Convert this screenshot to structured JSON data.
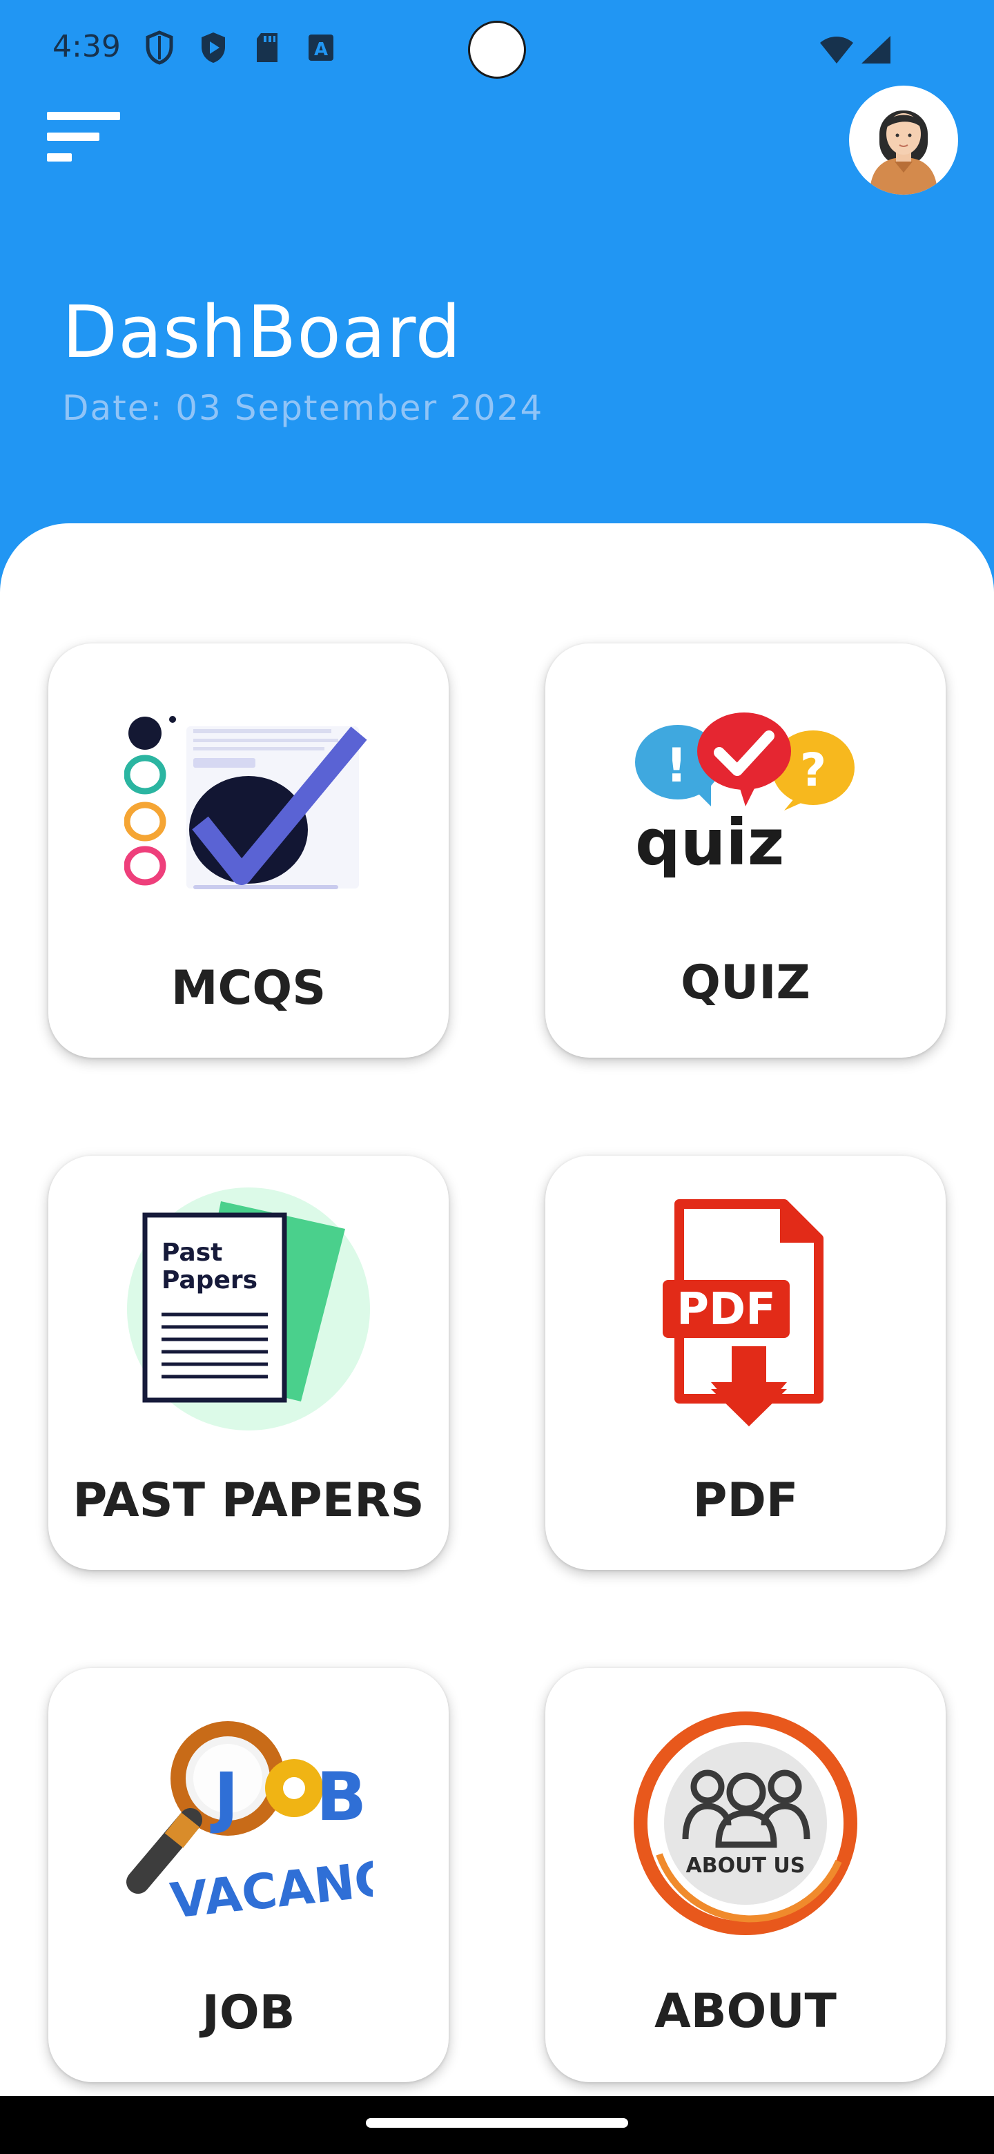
{
  "status_bar": {
    "time": "4:39",
    "icons": [
      "shield-icon",
      "play-protect-icon",
      "sd-card-icon",
      "font-a-icon"
    ],
    "right_icons": [
      "wifi-icon",
      "cell-signal-icon"
    ]
  },
  "header": {
    "menu_icon": "menu-icon",
    "avatar": "user-avatar",
    "title": "DashBoard",
    "date": "Date: 03 September 2024",
    "color": "#2196F3"
  },
  "cards": [
    {
      "label": "MCQS",
      "icon": "mcqs-checklist-icon"
    },
    {
      "label": "QUIZ",
      "icon": "quiz-bubbles-icon",
      "image_text": "quiz"
    },
    {
      "label": "PAST PAPERS",
      "icon": "past-papers-icon",
      "image_text": "Past Papers"
    },
    {
      "label": "PDF",
      "icon": "pdf-download-icon",
      "image_text": "PDF"
    },
    {
      "label": "JOB",
      "icon": "job-vacancy-icon",
      "image_text": "JOB VACANCY"
    },
    {
      "label": "ABOUT",
      "icon": "about-us-icon",
      "image_text": "ABOUT US"
    }
  ]
}
